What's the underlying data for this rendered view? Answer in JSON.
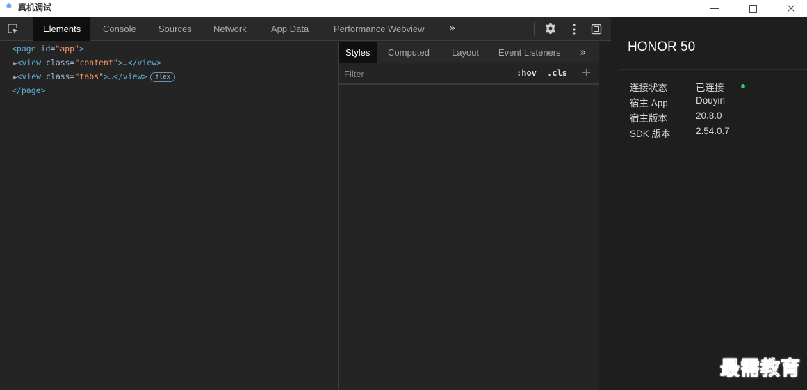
{
  "window": {
    "title": "真机调试",
    "icon": "asterisk-logo-icon"
  },
  "devtools": {
    "main_tabs": [
      "Elements",
      "Console",
      "Sources",
      "Network",
      "App Data",
      "Performance Webview"
    ],
    "active_tab": "Elements",
    "more_glyph": "»"
  },
  "dom_tree": {
    "line1": {
      "open": "<page",
      "attr": " id=",
      "value": "\"app\"",
      "close": ">"
    },
    "line2": {
      "open": "<view",
      "attr": " class=",
      "value": "\"content\"",
      "rest": ">…</view>"
    },
    "line3": {
      "open": "<view",
      "attr": " class=",
      "value": "\"tabs\"",
      "rest": ">…</view>",
      "badge": "flex"
    },
    "line4": "</page>"
  },
  "styles_pane": {
    "sub_tabs": [
      "Styles",
      "Computed",
      "Layout",
      "Event Listeners"
    ],
    "active_sub_tab": "Styles",
    "more_glyph": "»",
    "filter_placeholder": "Filter",
    "hov_label": ":hov",
    "cls_label": ".cls",
    "add_glyph": "+"
  },
  "device": {
    "name": "HONOR 50",
    "info": [
      {
        "label": "连接状态",
        "value": "已连接"
      },
      {
        "label": "宿主 App",
        "value": "Douyin"
      },
      {
        "label": "宿主版本",
        "value": "20.8.0"
      },
      {
        "label": "SDK 版本",
        "value": "2.54.0.7"
      }
    ],
    "status_color": "#3ec76a"
  },
  "watermark": "最需教育"
}
